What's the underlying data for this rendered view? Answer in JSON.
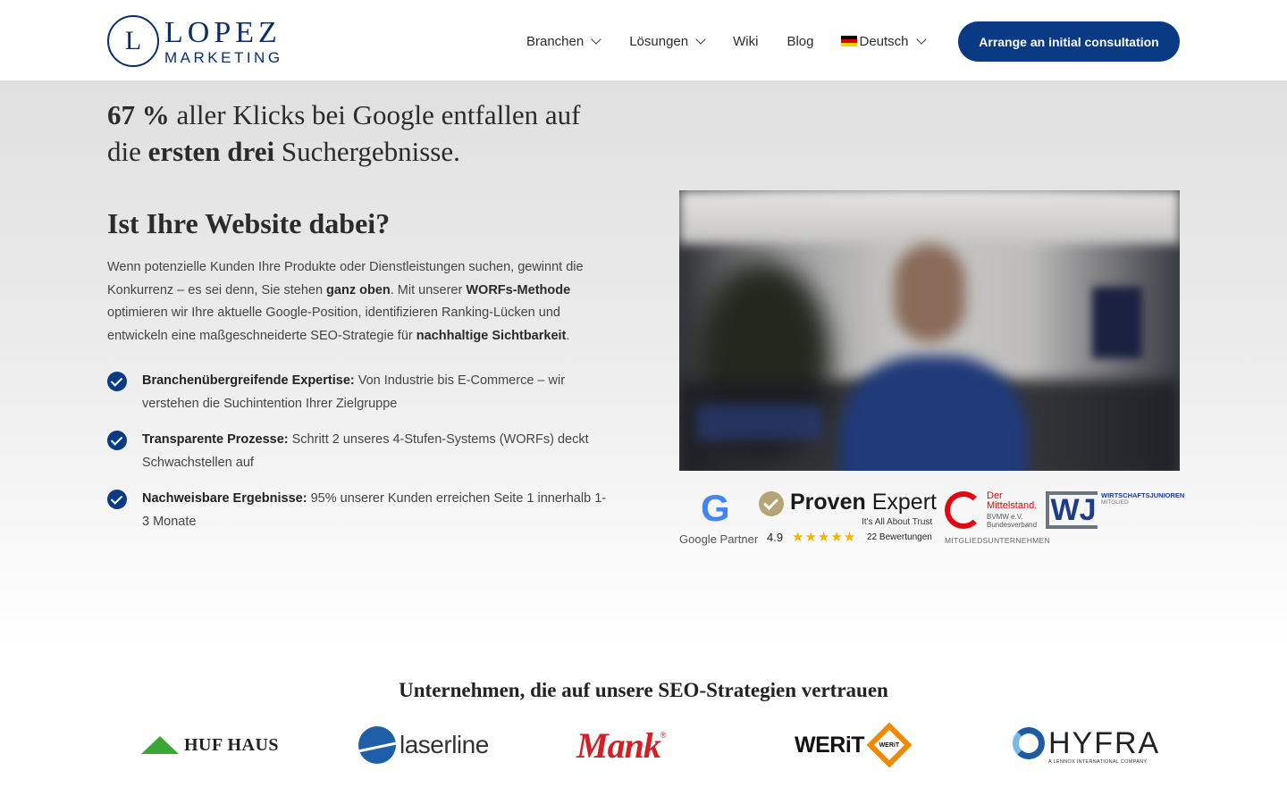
{
  "header": {
    "logo": {
      "mark": "L",
      "line1": "LOPEZ",
      "line2": "MARKETING"
    },
    "nav": [
      {
        "label": "Branchen",
        "dropdown": true
      },
      {
        "label": "Lösungen",
        "dropdown": true
      },
      {
        "label": "Wiki",
        "dropdown": false
      },
      {
        "label": "Blog",
        "dropdown": false
      },
      {
        "label": "Deutsch",
        "dropdown": true,
        "icon": "german-flag-icon"
      }
    ],
    "cta_label": "Arrange an initial consultation"
  },
  "hero": {
    "stat": {
      "part1_bold": "67 %",
      "part1": " aller Klicks bei Google entfallen auf die ",
      "part2_bold": "ersten drei",
      "part2": " Suchergebnisse."
    },
    "heading": "Ist Ihre Website dabei?",
    "paragraph": {
      "t1": "Wenn potenzielle Kunden Ihre Produkte oder Dienstleistungen suchen, gewinnt die Konkurrenz – es sei denn, Sie stehen ",
      "b1": "ganz oben",
      "t2": ". Mit unserer ",
      "b2": "WORFs-Methode",
      "t3": " optimieren wir Ihre aktuelle Google-Position, identifizieren Ranking-Lücken und entwickeln eine maßgeschneiderte SEO-Strategie für ",
      "b3": "nachhaltige Sichtbarkeit",
      "t4": "."
    },
    "checks": [
      {
        "bold": "Branchenübergreifende Expertise:",
        "text": " Von Industrie bis E-Commerce – wir verstehen die Suchintention Ihrer Zielgruppe"
      },
      {
        "bold": "Transparente Prozesse:",
        "text": " Schritt 2 unseres 4-Stufen-Systems (WORFs) deckt Schwachstellen auf"
      },
      {
        "bold": "Nachweisbare Ergebnisse:",
        "text": " 95% unserer Kunden erreichen Seite 1 innerhalb 1-3 Monate"
      }
    ]
  },
  "badges": {
    "google": {
      "letter": "G",
      "label": "Google Partner"
    },
    "proven_expert": {
      "title_bold": "Proven",
      "title": " Expert",
      "tagline": "It's All About Trust",
      "score": "4.9",
      "stars": "★★★★★",
      "reviews": "22 Bewertungen"
    },
    "mittelstand": {
      "title": "Der Mittelstand.",
      "sub1": "BVMW e.V.",
      "sub2": "Bundesverband",
      "member": "MITGLIEDSUNTERNEHMEN"
    },
    "wj": {
      "mark": "WJ",
      "title": "WIRTSCHAFTSJUNIOREN",
      "sub": "MITGLIED"
    }
  },
  "clients": {
    "title": "Unternehmen, die auf unsere SEO-Strategien vertrauen",
    "logos": {
      "huf": "HUF HAUS",
      "laserline": "laserline",
      "mank": "Mank",
      "mank_reg": "®",
      "werit": "WERiT",
      "werit_mark": "WERiT",
      "hyfra": "HYFRA",
      "hyfra_sub": "A LENNOX INTERNATIONAL COMPANY"
    }
  },
  "colors": {
    "brand_navy": "#0b3a85",
    "logo_navy": "#0b2e6b",
    "hero_gray": "#e0e0e0"
  }
}
